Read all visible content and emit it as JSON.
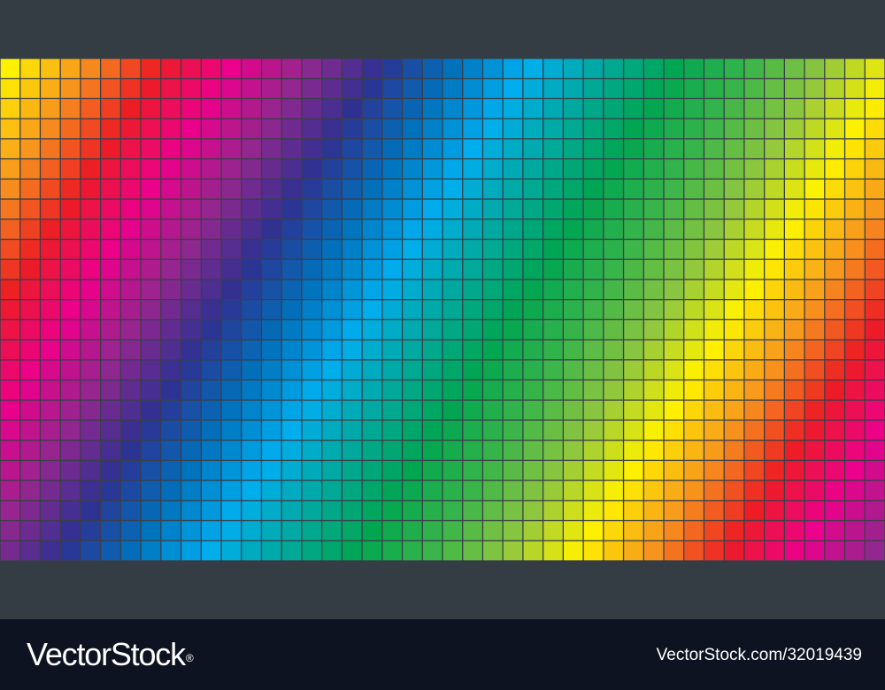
{
  "footer": {
    "brand": "VectorStock",
    "registered_mark": "®",
    "image_reference": "VectorStock.com/32019439"
  },
  "colors": {
    "frame": "#343c44",
    "footer_bg": "#0d1321",
    "grid_line": "#3a3f48"
  },
  "mosaic": {
    "columns": 44,
    "rows": 25,
    "palette": [
      "#fff200",
      "#f7941d",
      "#ed1c24",
      "#ec008c",
      "#92278f",
      "#2e3192",
      "#0072bc",
      "#00aeef",
      "#00a99d",
      "#00a651",
      "#39b54a",
      "#8dc63f",
      "#fff200",
      "#f7941d",
      "#ed1c24",
      "#ec008c",
      "#92278f"
    ]
  }
}
